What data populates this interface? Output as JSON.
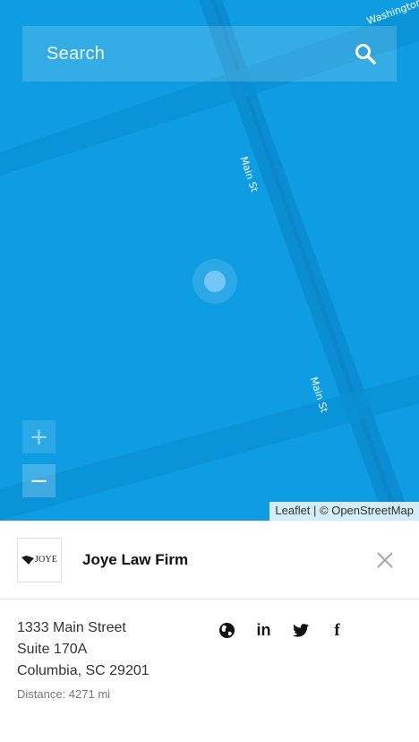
{
  "search": {
    "placeholder": "Search"
  },
  "map": {
    "streets": [
      "Main St",
      "Main St",
      "Washington"
    ],
    "attribution": "Leaflet | © OpenStreetMap",
    "colors": {
      "water": "#0e9ce2",
      "road": "#0a86c8"
    }
  },
  "zoom": {
    "in_label": "+",
    "out_label": "−"
  },
  "card": {
    "logo_text": "JOYE",
    "title": "Joye Law Firm",
    "address": [
      "1333 Main Street",
      "Suite 170A",
      "Columbia, SC 29201"
    ],
    "distance": "Distance: 4271 mi",
    "social_icons": [
      "globe-icon",
      "linkedin-icon",
      "twitter-icon",
      "facebook-icon"
    ],
    "social_labels": {
      "linkedin": "in",
      "facebook": "f"
    }
  }
}
